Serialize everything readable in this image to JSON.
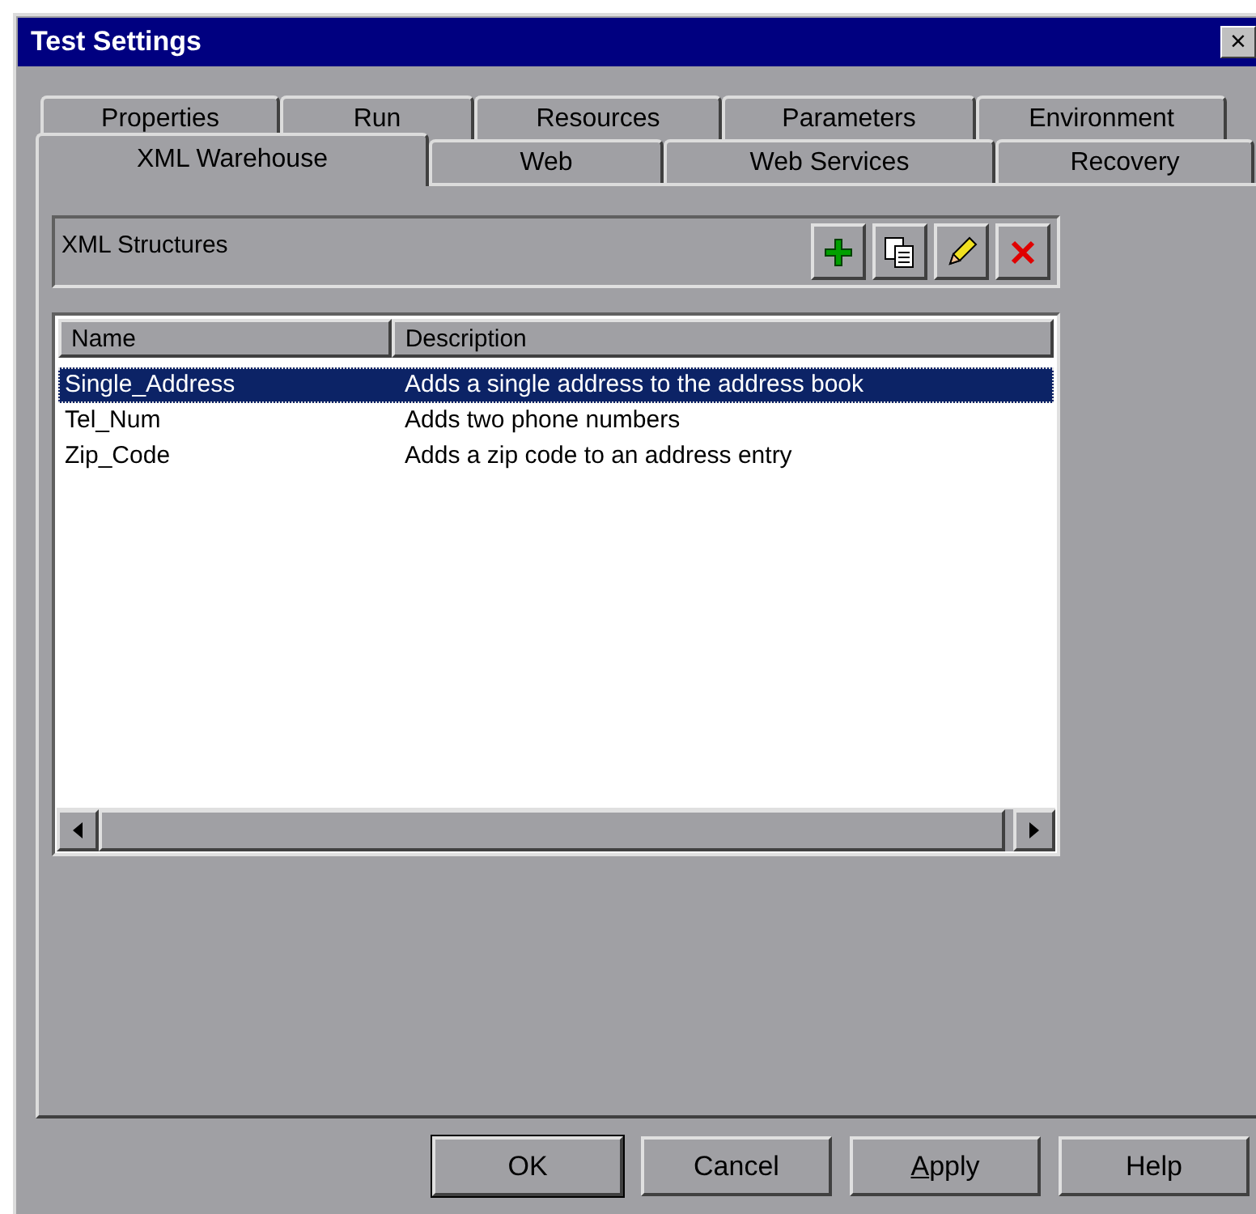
{
  "window": {
    "title": "Test Settings",
    "close": "×"
  },
  "tab_rows": [
    [
      {
        "label": "Properties",
        "selected": false
      },
      {
        "label": "Run",
        "selected": false
      },
      {
        "label": "Resources",
        "selected": false
      },
      {
        "label": "Parameters",
        "selected": false
      },
      {
        "label": "Environment",
        "selected": false
      }
    ],
    [
      {
        "label": "XML Warehouse",
        "selected": true
      },
      {
        "label": "Web",
        "selected": false
      },
      {
        "label": "Web Services",
        "selected": false
      },
      {
        "label": "Recovery",
        "selected": false
      }
    ]
  ],
  "group": {
    "title": "XML Structures",
    "tools": [
      {
        "kind": "add"
      },
      {
        "kind": "copy"
      },
      {
        "kind": "edit"
      },
      {
        "kind": "delete"
      }
    ]
  },
  "table": {
    "columns": [
      "Name",
      "Description"
    ],
    "rows": [
      {
        "cells": [
          "Single_Address",
          "Adds a single address to the address book"
        ],
        "selected": true
      },
      {
        "cells": [
          "Tel_Num",
          "Adds two phone numbers"
        ],
        "selected": false
      },
      {
        "cells": [
          "Zip_Code",
          "Adds a zip code to an address entry"
        ],
        "selected": false
      }
    ]
  },
  "buttons": [
    {
      "label": "OK",
      "default": true,
      "mnemonic": false
    },
    {
      "label": "Cancel",
      "default": false,
      "mnemonic": false
    },
    {
      "label": "Apply",
      "default": false,
      "mnemonic": true
    },
    {
      "label": "Help",
      "default": false,
      "mnemonic": false
    }
  ]
}
